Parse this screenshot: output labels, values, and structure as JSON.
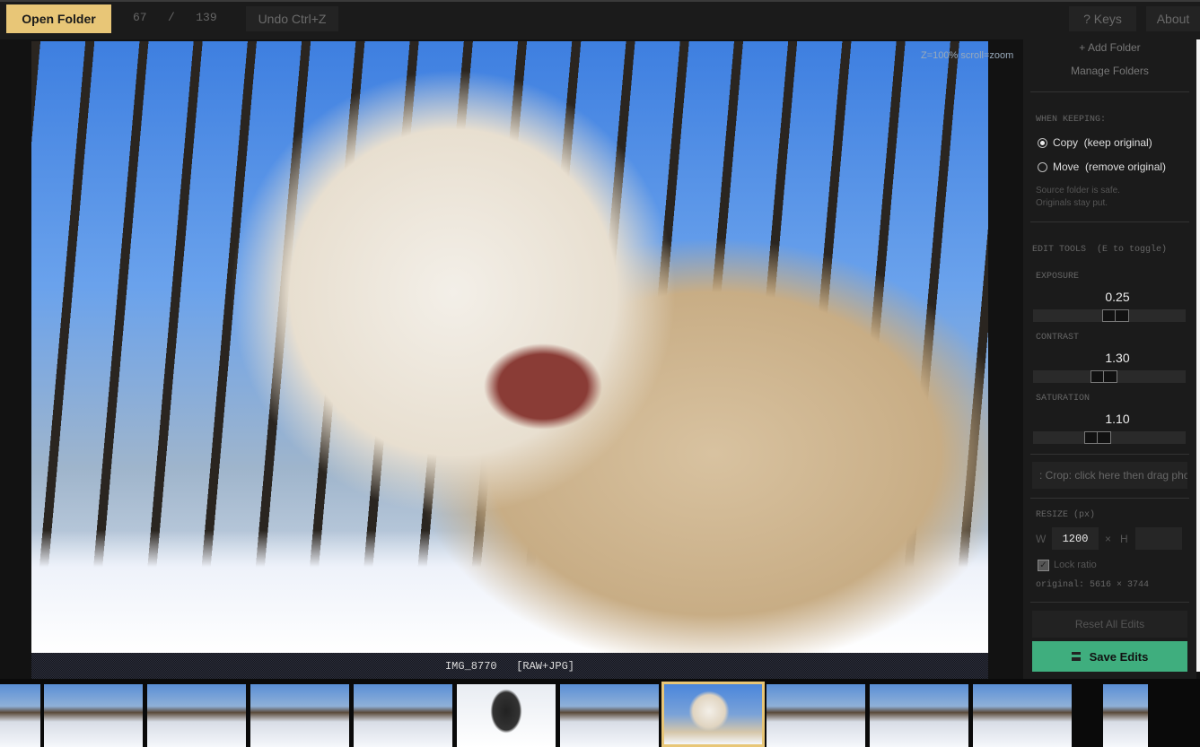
{
  "topbar": {
    "open_folder": "Open Folder",
    "current": "67",
    "separator": "/",
    "total": "139",
    "undo": "Undo  Ctrl+Z",
    "keys": "?  Keys",
    "about": "About"
  },
  "viewer": {
    "zoom_hint": "Z=100%  scroll=zoom",
    "caption": "IMG_8770   [RAW+JPG]"
  },
  "sidebar": {
    "add_folder": "+ Add Folder",
    "manage_folders": "Manage Folders",
    "when_keeping": "WHEN KEEPING:",
    "options": [
      {
        "label": "Copy  (keep original)",
        "selected": true
      },
      {
        "label": "Move  (remove original)",
        "selected": false
      }
    ],
    "note_line1": "Source folder is safe.",
    "note_line2": "Originals stay put.",
    "edit_tools": "EDIT TOOLS  (E to toggle)",
    "sliders": [
      {
        "label": "EXPOSURE",
        "value": "0.25",
        "fraction": 0.55
      },
      {
        "label": "CONTRAST",
        "value": "1.30",
        "fraction": 0.46
      },
      {
        "label": "SATURATION",
        "value": "1.10",
        "fraction": 0.41
      }
    ],
    "crop": ": Crop: click here then drag photo",
    "resize_label": "RESIZE (px)",
    "w_label": "W",
    "width_value": "1200",
    "times": "×",
    "h_label": "H",
    "height_value": "",
    "lock_ratio": "Lock ratio",
    "lock_checked": true,
    "original": "original: 5616 × 3744",
    "reset": "Reset All Edits",
    "save": "Save Edits"
  },
  "colors": {
    "accent": "#e8c677",
    "save": "#3fae7e"
  },
  "filmstrip": {
    "selected_index": 7,
    "count": 12
  }
}
